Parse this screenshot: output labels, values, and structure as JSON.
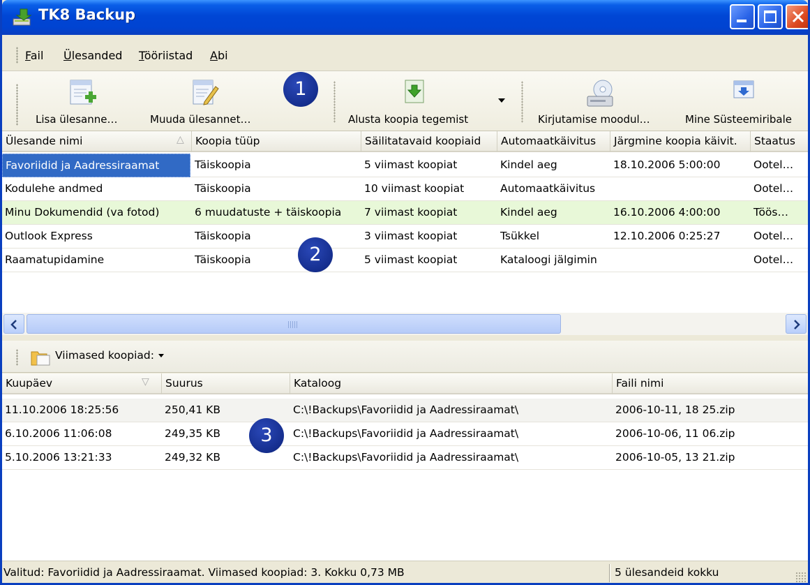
{
  "window": {
    "title": "TK8 Backup",
    "accent": "#0a3fbf"
  },
  "menu": [
    {
      "label": "Fail",
      "accel": "F",
      "rest": "ail"
    },
    {
      "label": "Ülesanded",
      "accel": "Ü",
      "rest": "lesanded"
    },
    {
      "label": "Tööriistad",
      "accel": "T",
      "rest": "ööriistad"
    },
    {
      "label": "Abi",
      "accel": "A",
      "rest": "bi"
    }
  ],
  "toolbar": {
    "add_task": "Lisa ülesanne…",
    "edit_task": "Muuda ülesannet…",
    "start_backup": "Alusta koopia tegemist",
    "write_module": "Kirjutamise moodul…",
    "to_tray": "Mine Süsteemiribale"
  },
  "badges": [
    "1",
    "2",
    "3"
  ],
  "tasks": {
    "columns": [
      "Ülesande nimi",
      "Koopia tüüp",
      "Säilitatavaid koopiaid",
      "Automaatkäivitus",
      "Järgmine koopia käivit.",
      "Staatus"
    ],
    "sort_indicator": "△",
    "rows": [
      {
        "name": "Favoriidid ja Aadressiraamat",
        "type": "Täiskoopia",
        "keep": "5 viimast koopiat",
        "auto": "Kindel aeg",
        "next": "18.10.2006 5:00:00",
        "status": "Ootel…",
        "selected": true
      },
      {
        "name": "Kodulehe andmed",
        "type": "Täiskoopia",
        "keep": "10 viimast koopiat",
        "auto": "Automaatkäivitus",
        "next": "",
        "status": "Ootel…"
      },
      {
        "name": "Minu Dokumendid (va fotod)",
        "type": "6 muudatuste + täiskoopia",
        "keep": "7 viimast koopiat",
        "auto": "Kindel aeg",
        "next": "16.10.2006 4:00:00",
        "status": "Töös…",
        "running": true
      },
      {
        "name": "Outlook Express",
        "type": "Täiskoopia",
        "keep": "3 viimast koopiat",
        "auto": "Tsükkel",
        "next": "12.10.2006 0:25:27",
        "status": "Ootel…"
      },
      {
        "name": "Raamatupidamine",
        "type": "Täiskoopia",
        "keep": "5 viimast koopiat",
        "auto": "Kataloogi jälgimin",
        "next": "",
        "status": "Ootel…"
      }
    ]
  },
  "recent": {
    "dropdown_label": "Viimased koopiad:",
    "columns": [
      "Kuupäev",
      "Suurus",
      "Kataloog",
      "Faili nimi"
    ],
    "sort_indicator": "▽",
    "rows": [
      {
        "date": "11.10.2006 18:25:56",
        "size": "250,41 KB",
        "dir": "C:\\!Backups\\Favoriidid ja Aadressiraamat\\",
        "file": "2006-10-11, 18 25.zip"
      },
      {
        "date": "6.10.2006 11:06:08",
        "size": "249,35 KB",
        "dir": "C:\\!Backups\\Favoriidid ja Aadressiraamat\\",
        "file": "2006-10-06, 11 06.zip"
      },
      {
        "date": "5.10.2006 13:21:33",
        "size": "249,32 KB",
        "dir": "C:\\!Backups\\Favoriidid ja Aadressiraamat\\",
        "file": "2006-10-05, 13 21.zip"
      }
    ]
  },
  "status": {
    "left": "Valitud: Favoriidid ja Aadressiraamat.   Viimased koopiad: 3.   Kokku 0,73 MB",
    "right": "5 ülesandeid kokku"
  }
}
